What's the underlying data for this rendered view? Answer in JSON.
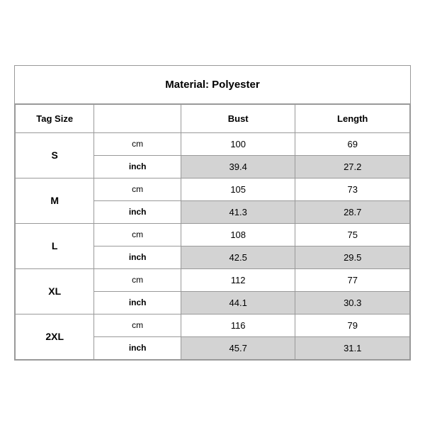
{
  "title": "Material: Polyester",
  "headers": {
    "tag_size": "Tag Size",
    "bust": "Bust",
    "length": "Length"
  },
  "sizes": [
    {
      "tag": "S",
      "cm": {
        "bust": "100",
        "length": "69"
      },
      "inch": {
        "bust": "39.4",
        "length": "27.2"
      }
    },
    {
      "tag": "M",
      "cm": {
        "bust": "105",
        "length": "73"
      },
      "inch": {
        "bust": "41.3",
        "length": "28.7"
      }
    },
    {
      "tag": "L",
      "cm": {
        "bust": "108",
        "length": "75"
      },
      "inch": {
        "bust": "42.5",
        "length": "29.5"
      }
    },
    {
      "tag": "XL",
      "cm": {
        "bust": "112",
        "length": "77"
      },
      "inch": {
        "bust": "44.1",
        "length": "30.3"
      }
    },
    {
      "tag": "2XL",
      "cm": {
        "bust": "116",
        "length": "79"
      },
      "inch": {
        "bust": "45.7",
        "length": "31.1"
      }
    }
  ],
  "unit_cm": "cm",
  "unit_inch": "inch"
}
